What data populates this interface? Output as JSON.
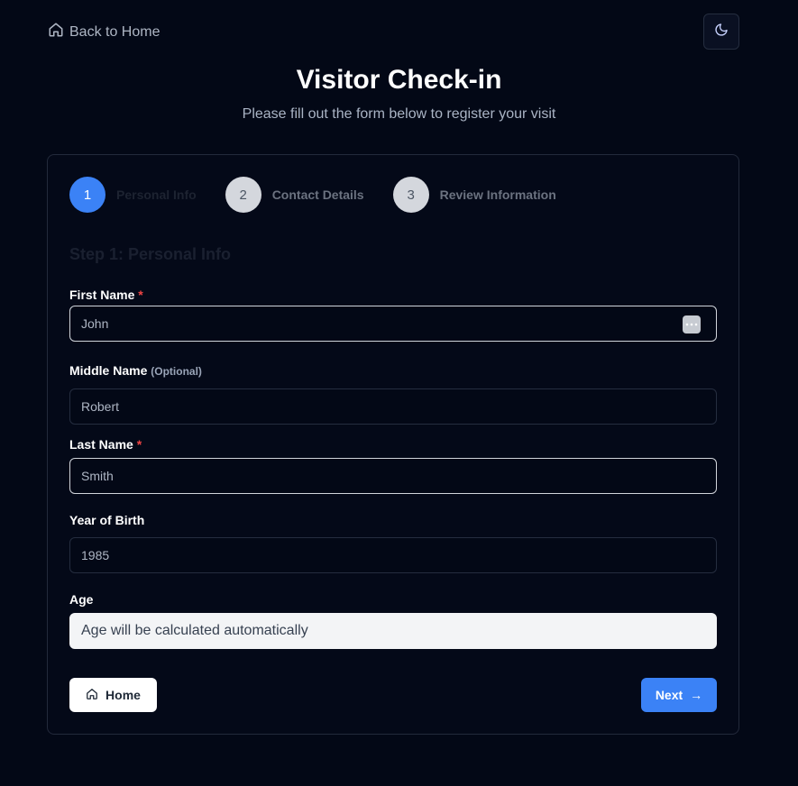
{
  "nav": {
    "back_label": "Back to Home",
    "back_icon": "home-icon",
    "theme_icon": "moon-icon"
  },
  "header": {
    "title": "Visitor Check-in",
    "subtitle": "Please fill out the form below to register your visit"
  },
  "stepper": {
    "steps": [
      {
        "number": "1",
        "label": "Personal Info",
        "active": true
      },
      {
        "number": "2",
        "label": "Contact Details",
        "active": false
      },
      {
        "number": "3",
        "label": "Review Information",
        "active": false
      }
    ]
  },
  "form": {
    "heading": "Step 1: Personal Info",
    "first_name": {
      "label": "First Name",
      "required_mark": "*",
      "value": "John"
    },
    "middle_name": {
      "label": "Middle Name",
      "optional": "(Optional)",
      "value": "Robert"
    },
    "last_name": {
      "label": "Last Name",
      "required_mark": "*",
      "value": "Smith"
    },
    "year_of_birth": {
      "label": "Year of Birth",
      "value": "1985"
    },
    "age": {
      "label": "Age",
      "placeholder": "Age will be calculated automatically"
    }
  },
  "actions": {
    "home_label": "Home",
    "next_label": "Next",
    "next_arrow": "→"
  },
  "colors": {
    "background": "#030816",
    "accent": "#3b82f6",
    "required": "#ef4444"
  }
}
